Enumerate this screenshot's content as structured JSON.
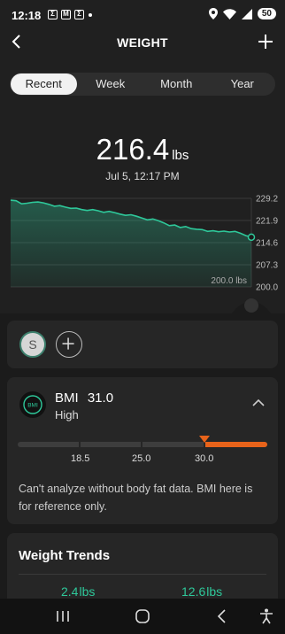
{
  "status_bar": {
    "time": "12:18",
    "battery": "50",
    "notification_icons": [
      "Σ",
      "M",
      "Σ"
    ]
  },
  "header": {
    "title": "WEIGHT"
  },
  "tabs": [
    {
      "label": "Recent",
      "active": true
    },
    {
      "label": "Week",
      "active": false
    },
    {
      "label": "Month",
      "active": false
    },
    {
      "label": "Year",
      "active": false
    }
  ],
  "reading": {
    "value": "216.4",
    "unit": "lbs",
    "datetime": "Jul 5, 12:17 PM"
  },
  "chart_data": {
    "type": "area",
    "y_ticks": [
      "229.2",
      "221.9",
      "214.6",
      "207.3",
      "200.0"
    ],
    "ylim": [
      200.0,
      229.2
    ],
    "baseline_label": "200.0 lbs",
    "values": [
      228.6,
      228.4,
      227.4,
      227.6,
      227.9,
      228.0,
      227.7,
      227.2,
      226.6,
      226.8,
      226.3,
      225.9,
      226.0,
      225.5,
      225.2,
      225.5,
      225.1,
      224.6,
      224.9,
      224.5,
      224.0,
      223.6,
      223.8,
      223.3,
      222.7,
      222.1,
      222.4,
      221.8,
      221.1,
      220.2,
      220.4,
      219.6,
      219.9,
      219.2,
      219.0,
      218.9,
      218.3,
      218.5,
      218.2,
      218.4,
      218.1,
      218.3,
      217.7,
      216.9,
      216.4
    ],
    "line_color": "#2ec89a",
    "grid": true
  },
  "member": {
    "avatar_initial": "S"
  },
  "bmi": {
    "label": "BMI",
    "value": "31.0",
    "status": "High",
    "scale_labels": [
      "18.5",
      "25.0",
      "30.0"
    ],
    "marker_value": 31.0,
    "note": "Can't analyze without body fat data. BMI here is for reference only.",
    "accent_color": "#e8631a"
  },
  "trends": {
    "title": "Weight Trends",
    "values": [
      {
        "value": "2.4",
        "unit": "lbs"
      },
      {
        "value": "12.6",
        "unit": "lbs"
      }
    ]
  },
  "colors": {
    "accent_green": "#2ec89a",
    "accent_orange": "#e8631a",
    "background": "#1b1b1b"
  }
}
